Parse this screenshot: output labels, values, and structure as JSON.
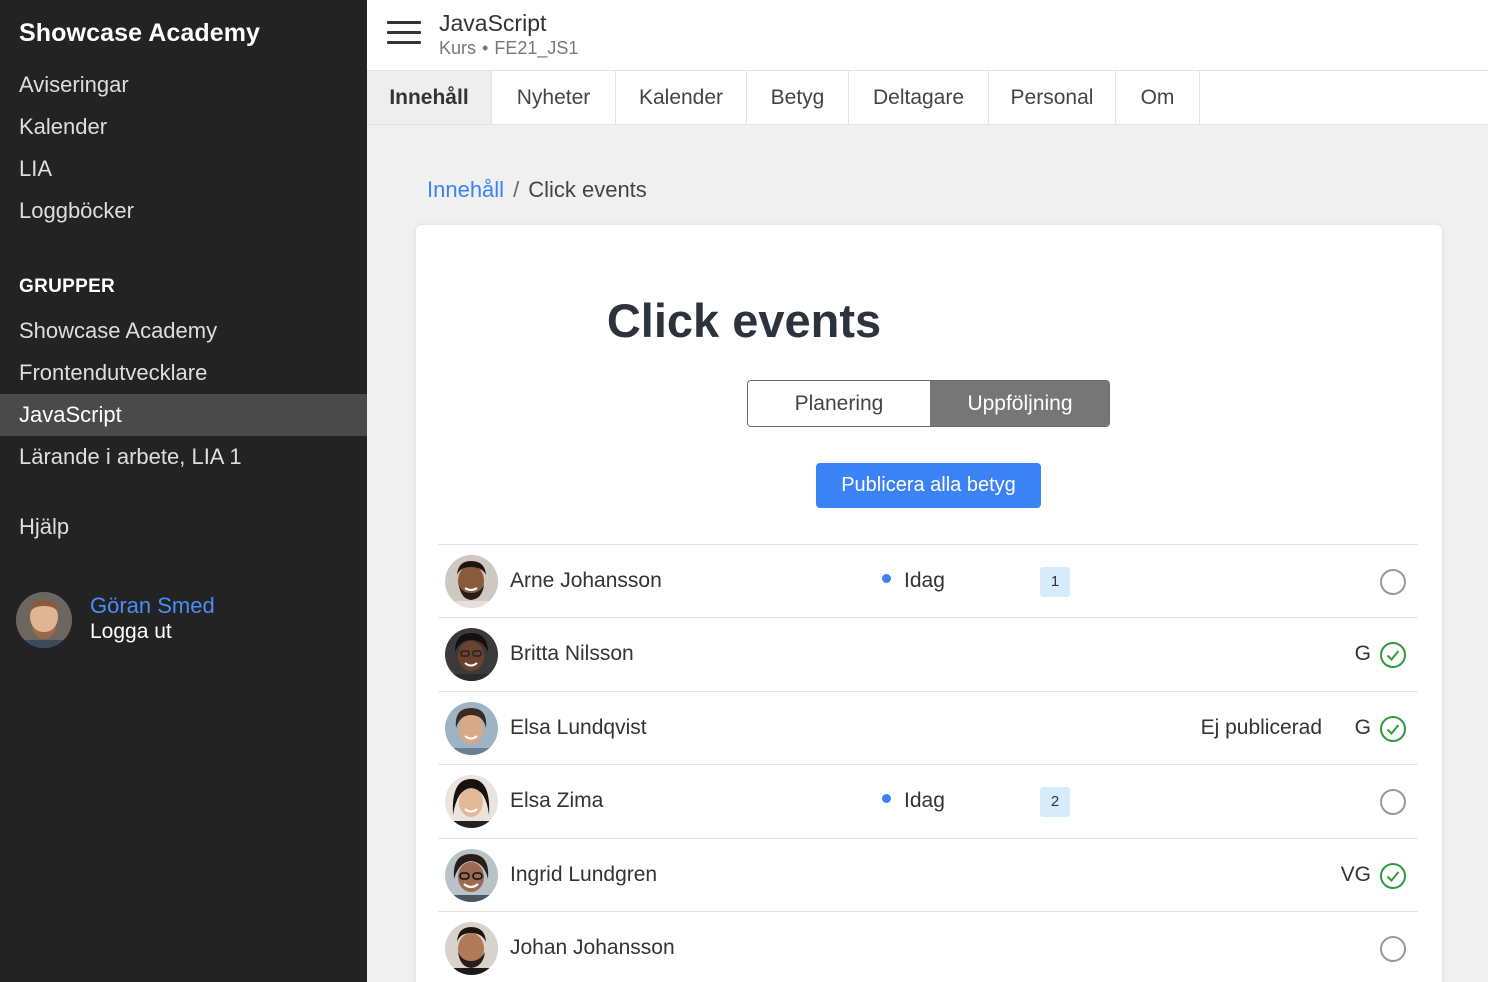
{
  "sidebar": {
    "brand": "Showcase Academy",
    "links": [
      "Aviseringar",
      "Kalender",
      "LIA",
      "Loggböcker"
    ],
    "groups_heading": "GRUPPER",
    "groups": [
      "Showcase Academy",
      "Frontendutvecklare",
      "JavaScript",
      "Lärande i arbete, LIA 1"
    ],
    "help": "Hjälp",
    "user_name": "Göran Smed",
    "logout": "Logga ut"
  },
  "header": {
    "title": "JavaScript",
    "type": "Kurs",
    "separator": "•",
    "code": "FE21_JS1"
  },
  "tabs": [
    "Innehåll",
    "Nyheter",
    "Kalender",
    "Betyg",
    "Deltagare",
    "Personal",
    "Om"
  ],
  "breadcrumb": {
    "parent": "Innehåll",
    "separator": "/",
    "current": "Click events"
  },
  "page": {
    "title": "Click events",
    "segments": [
      "Planering",
      "Uppföljning"
    ],
    "publish_button": "Publicera alla betyg"
  },
  "students": [
    {
      "name": "Arne Johansson",
      "status": "Idag",
      "badge": "1",
      "unpublished": "",
      "grade": "",
      "done": false
    },
    {
      "name": "Britta Nilsson",
      "status": "",
      "badge": "",
      "unpublished": "",
      "grade": "G",
      "done": true
    },
    {
      "name": "Elsa Lundqvist",
      "status": "",
      "badge": "",
      "unpublished": "Ej publicerad",
      "grade": "G",
      "done": true
    },
    {
      "name": "Elsa Zima",
      "status": "Idag",
      "badge": "2",
      "unpublished": "",
      "grade": "",
      "done": false
    },
    {
      "name": "Ingrid Lundgren",
      "status": "",
      "badge": "",
      "unpublished": "",
      "grade": "VG",
      "done": true
    },
    {
      "name": "Johan Johansson",
      "status": "",
      "badge": "",
      "unpublished": "",
      "grade": "",
      "done": false
    }
  ],
  "colors": {
    "accent": "#3b82f6",
    "success": "#2e9a3a",
    "sidebar_bg": "#232323",
    "active_nav": "#4a4a4a"
  },
  "icons": {
    "menu": "hamburger-icon",
    "done": "check-circle-icon",
    "pending": "empty-circle-icon"
  }
}
